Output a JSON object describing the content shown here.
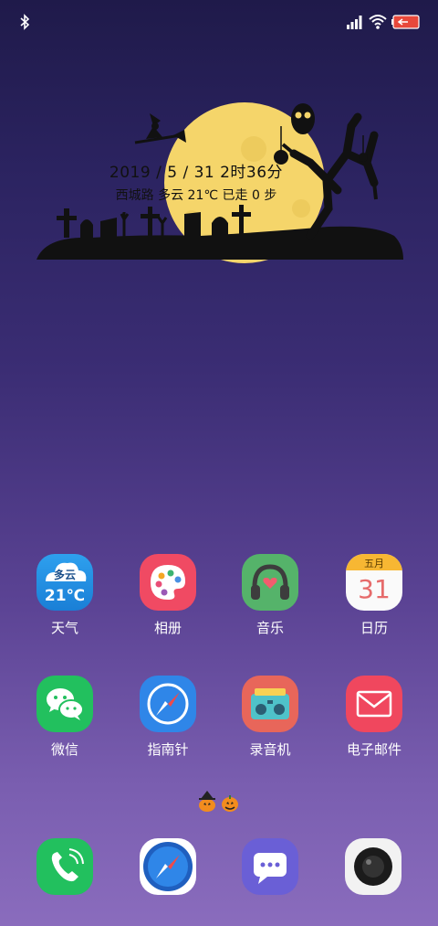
{
  "status": {
    "bluetooth_icon": "bluetooth-icon",
    "signal_icon": "cellular-signal-icon",
    "wifi_icon": "wifi-icon",
    "battery_icon": "battery-icon",
    "battery_color": "#e8483b"
  },
  "widget": {
    "date_time": "2019 / 5 / 31   2时36分",
    "info": "西城路 多云 21℃  已走 0 步",
    "moon_color": "#f5d56a",
    "theme": "halloween-graveyard"
  },
  "apps_row1": [
    {
      "label": "天气",
      "icon": "weather-icon",
      "weather_text": "多云",
      "temp": "21℃"
    },
    {
      "label": "相册",
      "icon": "gallery-palette-icon"
    },
    {
      "label": "音乐",
      "icon": "music-headphones-icon"
    },
    {
      "label": "日历",
      "icon": "calendar-icon",
      "month": "五月",
      "day": "31"
    }
  ],
  "apps_row2": [
    {
      "label": "微信",
      "icon": "wechat-icon"
    },
    {
      "label": "指南针",
      "icon": "compass-icon"
    },
    {
      "label": "录音机",
      "icon": "recorder-radio-icon"
    },
    {
      "label": "电子邮件",
      "icon": "email-envelope-icon"
    }
  ],
  "page_indicator": {
    "icons": [
      "witch-pumpkin-icon",
      "pumpkin-icon"
    ],
    "pages": 2,
    "current": 1
  },
  "dock": [
    {
      "icon": "phone-icon"
    },
    {
      "icon": "browser-compass-icon"
    },
    {
      "icon": "messages-icon"
    },
    {
      "icon": "camera-icon"
    }
  ]
}
